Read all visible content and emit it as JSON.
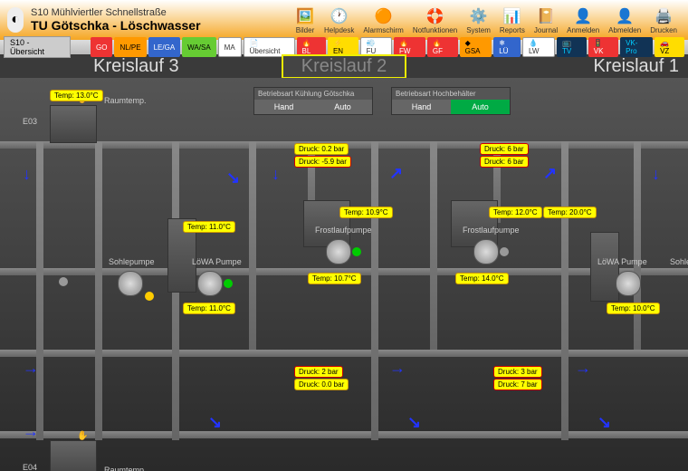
{
  "header": {
    "title1": "S10 Mühlviertler Schnellstraße",
    "title2": "TU Götschka - Löschwasser"
  },
  "toolbar": [
    {
      "name": "bilder",
      "label": "Bilder",
      "icon": "🖼️"
    },
    {
      "name": "helpdesk",
      "label": "Helpdesk",
      "icon": "🕐"
    },
    {
      "name": "alarmschirm",
      "label": "Alarmschirm",
      "icon": "🟠"
    },
    {
      "name": "notfunktionen",
      "label": "Notfunktionen",
      "icon": "🛟"
    },
    {
      "name": "system",
      "label": "System",
      "icon": "⚙️"
    },
    {
      "name": "reports",
      "label": "Reports",
      "icon": "📊"
    },
    {
      "name": "journal",
      "label": "Journal",
      "icon": "📔"
    },
    {
      "name": "anmelden",
      "label": "Anmelden",
      "icon": "👤"
    },
    {
      "name": "abmelden",
      "label": "Abmelden",
      "icon": "👤"
    },
    {
      "name": "drucken",
      "label": "Drucken",
      "icon": "🖨️"
    }
  ],
  "nav": {
    "back": "S10 - Übersicht",
    "chips": [
      {
        "c": "red",
        "t": "GO"
      },
      {
        "c": "orange",
        "t": "NL/PE"
      },
      {
        "c": "blue",
        "t": "LE/GA"
      },
      {
        "c": "green",
        "t": "WA/SA"
      },
      {
        "c": "white",
        "t": "MA"
      },
      {
        "c": "white",
        "t": "📄 Übersicht"
      },
      {
        "c": "red",
        "t": "🔥 BL"
      },
      {
        "c": "yellow",
        "t": "⚡ EN"
      },
      {
        "c": "white",
        "t": "💨 FU"
      },
      {
        "c": "red",
        "t": "🔥 FW"
      },
      {
        "c": "red",
        "t": "🔥 GF"
      },
      {
        "c": "orange",
        "t": "◆  GSA"
      },
      {
        "c": "blue",
        "t": "❄  LÜ"
      },
      {
        "c": "white",
        "t": "💧 LW"
      },
      {
        "c": "dark",
        "t": "📺 TV"
      },
      {
        "c": "red",
        "t": "🚦 VK"
      },
      {
        "c": "dark",
        "t": "VK-Pro"
      },
      {
        "c": "yellow",
        "t": "🚗 VZ"
      }
    ]
  },
  "circuits": {
    "c1": "Kreislauf 3",
    "c2": "Kreislauf 2",
    "c3": "Kreislauf 1"
  },
  "modes": [
    {
      "title": "Betriebsart Kühlung Götschka",
      "hand": "Hand",
      "auto": "Auto",
      "active": "hand"
    },
    {
      "title": "Betriebsart Hochbehälter",
      "hand": "Hand",
      "auto": "Auto",
      "active": "auto"
    }
  ],
  "tags": {
    "temp13": "Temp: 13.0°C",
    "raumtemp": "Raumtemp.",
    "druck02": "Druck: 0.2 bar",
    "druck59": "Druck: -5.9 bar",
    "druck6a": "Druck: 6 bar",
    "druck6b": "Druck: 6 bar",
    "temp109": "Temp: 10.9°C",
    "temp120": "Temp: 12.0°C",
    "temp200": "Temp: 20.0°C",
    "temp110a": "Temp: 11.0°C",
    "temp107": "Temp: 10.7°C",
    "temp140": "Temp: 14.0°C",
    "temp110b": "Temp: 11.0°C",
    "temp100": "Temp: 10.0°C",
    "druck2": "Druck: 2 bar",
    "druck00": "Druck: 0.0 bar",
    "druck3": "Druck: 3 bar",
    "druck7": "Druck: 7 bar",
    "sohlepumpe": "Sohlepumpe",
    "lowa": "LöWA Pumpe",
    "frost": "Frostlaufpumpe",
    "sohle": "Sohle",
    "e03": "E03",
    "e04": "E04"
  }
}
